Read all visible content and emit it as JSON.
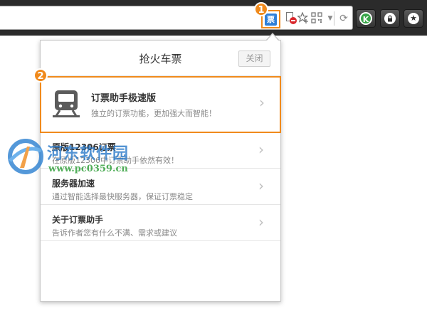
{
  "toolbar": {
    "ticket_extension_glyph": "票",
    "reload_glyph": "⟳",
    "k_glyph": "K",
    "lock_glyph": "🔒",
    "star_glyph": "★"
  },
  "annotations": {
    "badge_1": "1",
    "badge_2": "2"
  },
  "popup": {
    "title": "抢火车票",
    "close_label": "关闭",
    "featured": {
      "label": "订票助手极速版",
      "desc": "独立的订票功能，更加强大而智能！",
      "icon": "train-icon"
    },
    "items": [
      {
        "label": "原版12306订票",
        "desc": "在原版12306中订票助手依然有效！"
      },
      {
        "label": "服务器加速",
        "desc": "通过智能选择最快服务器，保证订票稳定"
      },
      {
        "label": "关于订票助手",
        "desc": "告诉作者您有什么不满、需求或建议"
      }
    ]
  },
  "watermark": {
    "name": "河东软件园",
    "url": "www.pc0359.cn"
  },
  "colors": {
    "accent": "#f08a1c",
    "toolbar_bg": "#2b2b2b",
    "ticket_blue": "#2f7fd8"
  }
}
